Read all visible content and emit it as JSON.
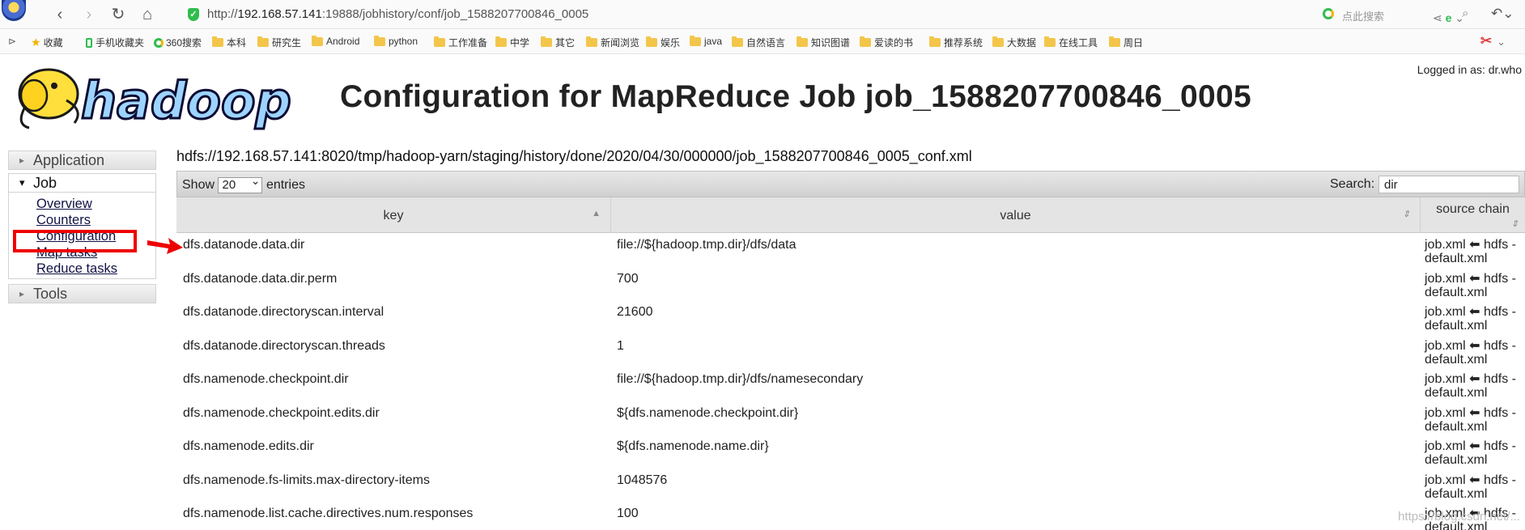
{
  "browser": {
    "url_prefix": "http://",
    "url_host": "192.168.57.141",
    "url_rest": ":19888/jobhistory/conf/job_1588207700846_0005",
    "search_placeholder": "点此搜索",
    "nav": {
      "back": "‹",
      "forward": "›",
      "reload": "↻",
      "home": "⌂"
    }
  },
  "bookmarks": [
    {
      "label": "收藏",
      "icon": "star-icon"
    },
    {
      "label": "手机收藏夹",
      "icon": "phone-icon"
    },
    {
      "label": "360搜索",
      "icon": "360-icon"
    },
    {
      "label": "本科",
      "icon": "folder-icon"
    },
    {
      "label": "研究生",
      "icon": "folder-icon"
    },
    {
      "label": "Android",
      "icon": "folder-icon"
    },
    {
      "label": "python",
      "icon": "folder-icon"
    },
    {
      "label": "工作准备",
      "icon": "folder-icon"
    },
    {
      "label": "中学",
      "icon": "folder-icon"
    },
    {
      "label": "其它",
      "icon": "folder-icon"
    },
    {
      "label": "新闻浏览",
      "icon": "folder-icon"
    },
    {
      "label": "娱乐",
      "icon": "folder-icon"
    },
    {
      "label": "java",
      "icon": "folder-icon"
    },
    {
      "label": "自然语言",
      "icon": "folder-icon"
    },
    {
      "label": "知识图谱",
      "icon": "folder-icon"
    },
    {
      "label": "爱读的书",
      "icon": "folder-icon"
    },
    {
      "label": "推荐系统",
      "icon": "folder-icon"
    },
    {
      "label": "大数据",
      "icon": "folder-icon"
    },
    {
      "label": "在线工具",
      "icon": "folder-icon"
    },
    {
      "label": "周日",
      "icon": "folder-icon"
    }
  ],
  "page": {
    "logged_in": "Logged in as: dr.who",
    "logo_text": "hadoop",
    "title": "Configuration for MapReduce Job job_1588207700846_0005",
    "conf_path": "hdfs://192.168.57.141:8020/tmp/hadoop-yarn/staging/history/done/2020/04/30/000000/job_1588207700846_0005_conf.xml"
  },
  "sidebar": {
    "application": "Application",
    "job": "Job",
    "job_links": [
      "Overview",
      "Counters",
      "Configuration",
      "Map tasks",
      "Reduce tasks"
    ],
    "tools": "Tools"
  },
  "table": {
    "show_label": "Show",
    "entries_value": "20",
    "entries_label": "entries",
    "search_label": "Search:",
    "search_value": "dir",
    "columns": [
      "key",
      "value",
      "source chain"
    ],
    "rows": [
      {
        "key": "dfs.datanode.data.dir",
        "value": "file://${hadoop.tmp.dir}/dfs/data",
        "source": "job.xml ⬅ hdfs -default.xml"
      },
      {
        "key": "dfs.datanode.data.dir.perm",
        "value": "700",
        "source": "job.xml ⬅ hdfs -default.xml"
      },
      {
        "key": "dfs.datanode.directoryscan.interval",
        "value": "21600",
        "source": "job.xml ⬅ hdfs -default.xml"
      },
      {
        "key": "dfs.datanode.directoryscan.threads",
        "value": "1",
        "source": "job.xml ⬅ hdfs -default.xml"
      },
      {
        "key": "dfs.namenode.checkpoint.dir",
        "value": "file://${hadoop.tmp.dir}/dfs/namesecondary",
        "source": "job.xml ⬅ hdfs -default.xml"
      },
      {
        "key": "dfs.namenode.checkpoint.edits.dir",
        "value": "${dfs.namenode.checkpoint.dir}",
        "source": "job.xml ⬅ hdfs -default.xml"
      },
      {
        "key": "dfs.namenode.edits.dir",
        "value": "${dfs.namenode.name.dir}",
        "source": "job.xml ⬅ hdfs -default.xml"
      },
      {
        "key": "dfs.namenode.fs-limits.max-directory-items",
        "value": "1048576",
        "source": "job.xml ⬅ hdfs -default.xml"
      },
      {
        "key": "dfs.namenode.list.cache.directives.num.responses",
        "value": "100",
        "source": "job.xml ⬅ hdfs -default.xml"
      }
    ]
  },
  "watermark": "https://blog.csdn.net/..."
}
